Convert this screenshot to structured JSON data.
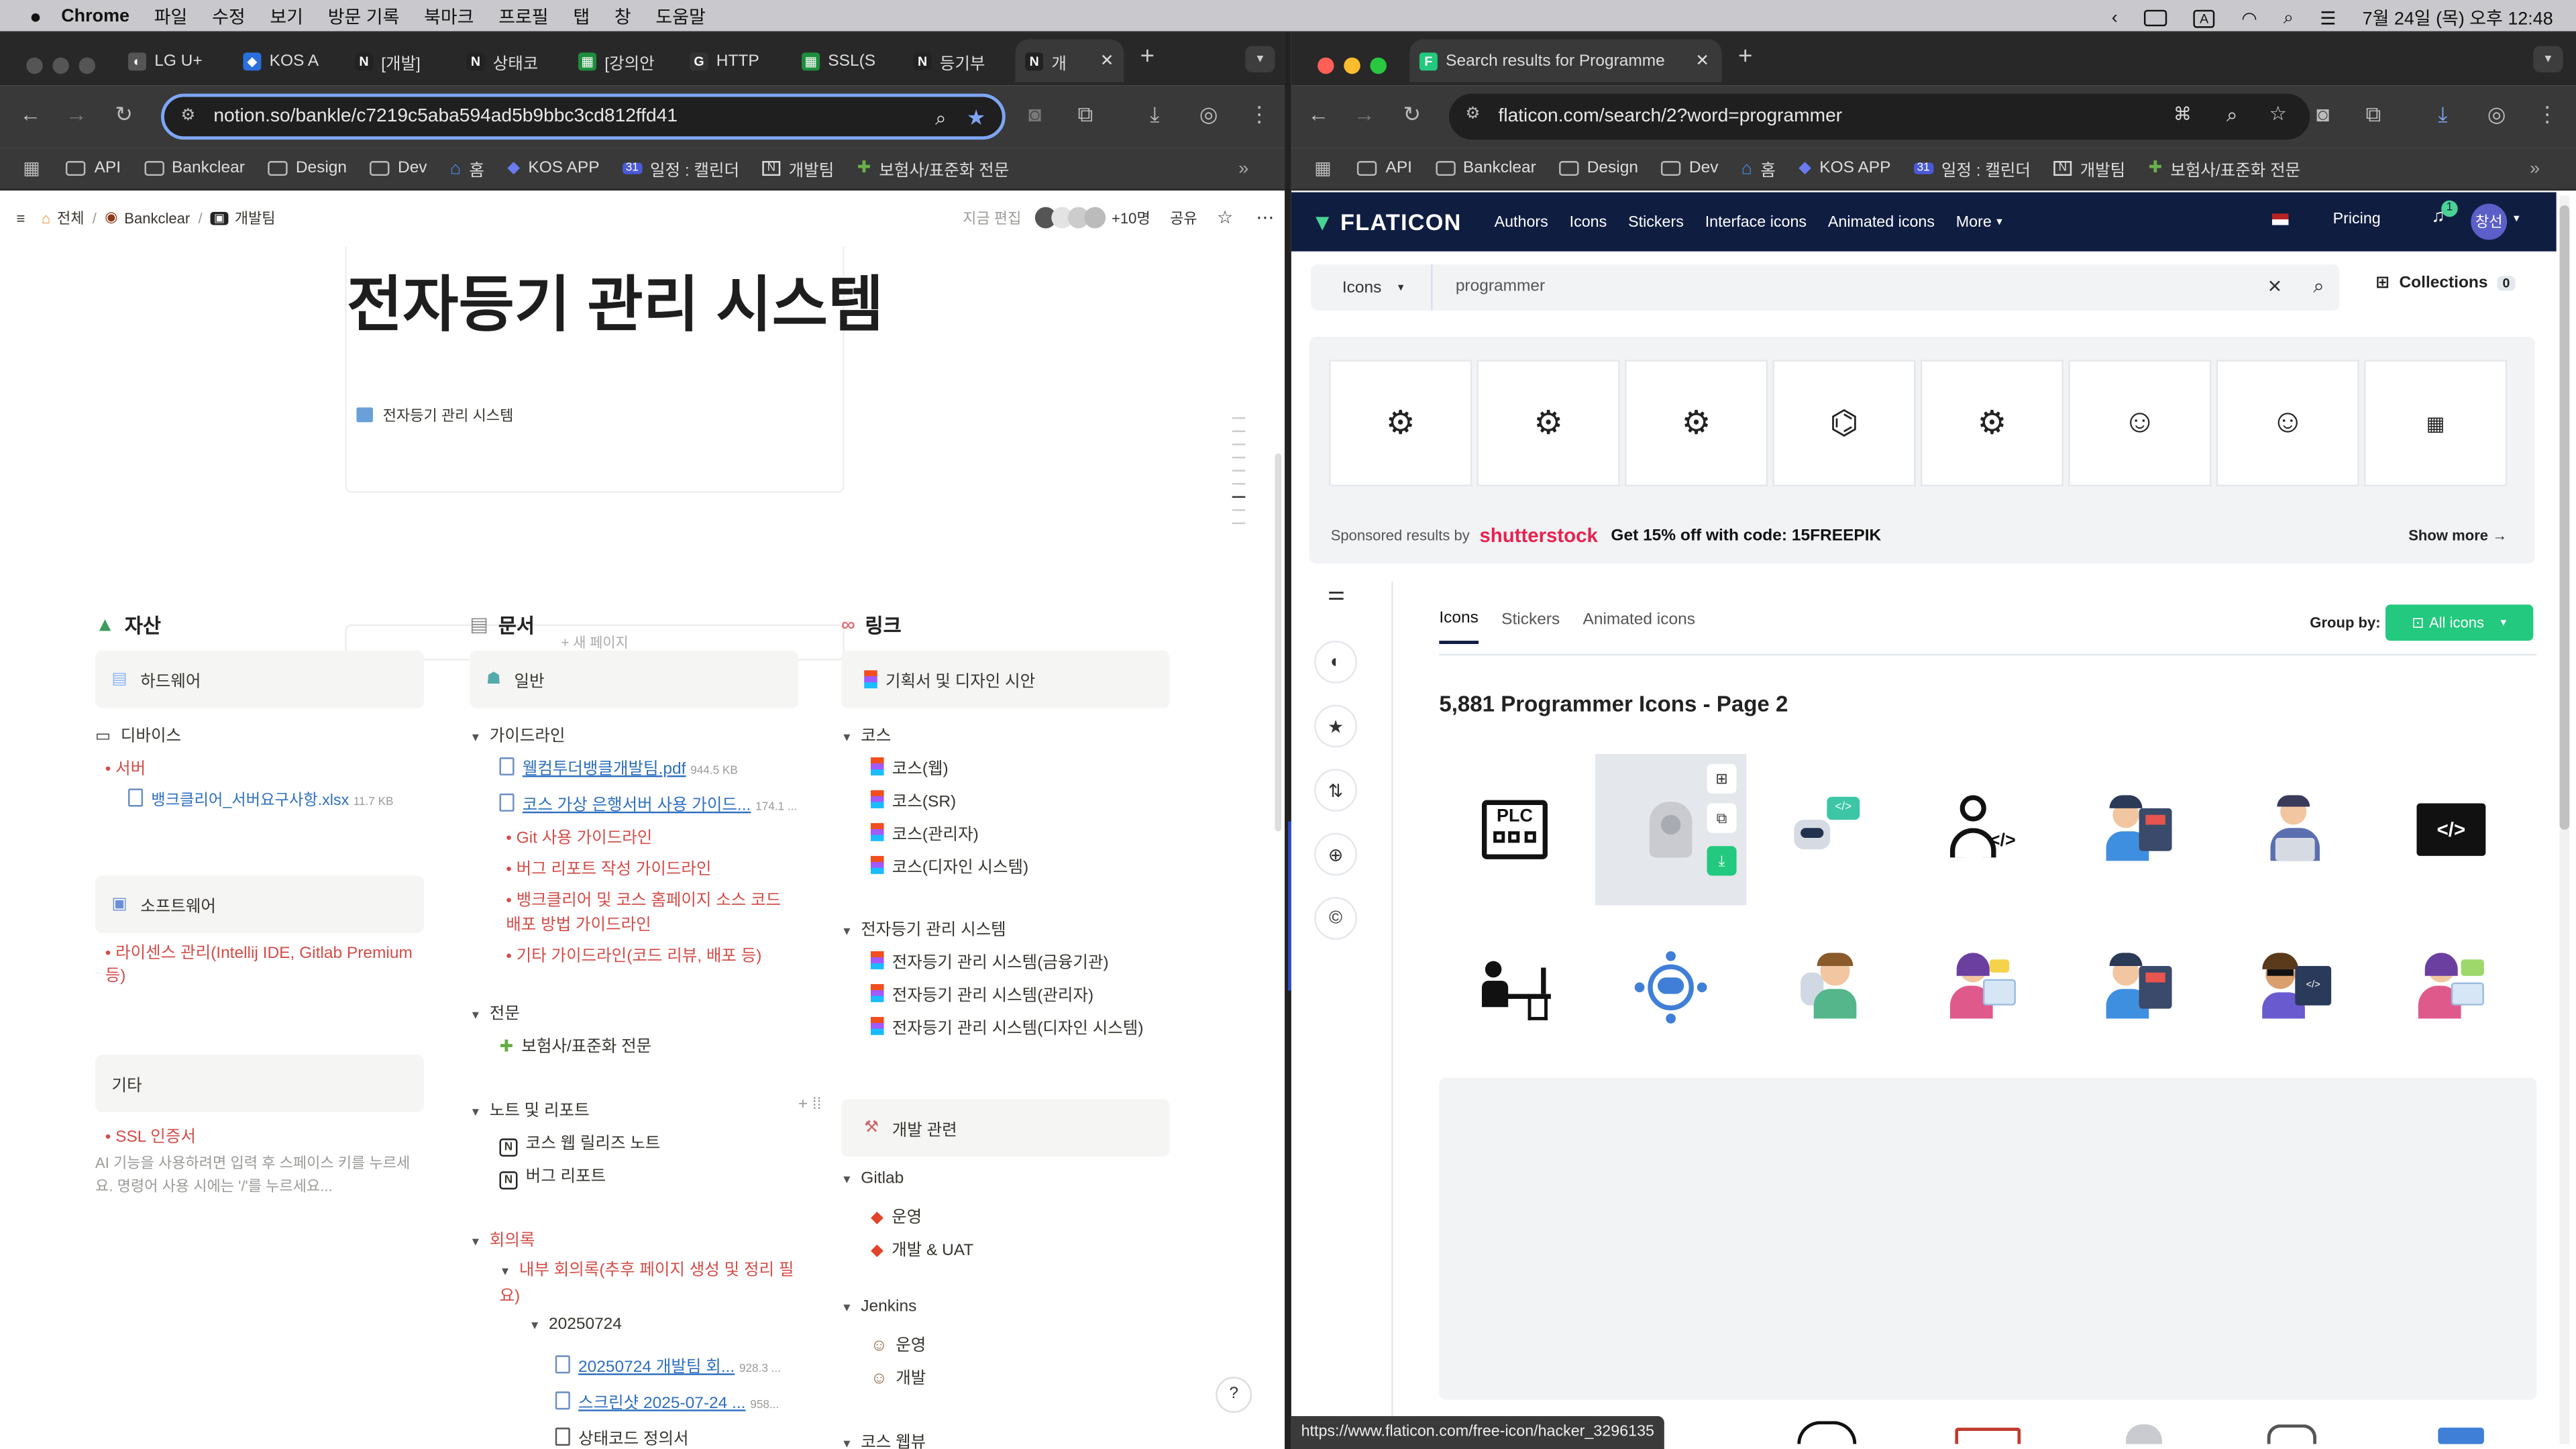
{
  "menubar": {
    "apple": "",
    "app": "Chrome",
    "items": [
      "파일",
      "수정",
      "보기",
      "방문 기록",
      "북마크",
      "프로필",
      "탭",
      "창",
      "도움말"
    ],
    "input": "A",
    "clock": "7월 24일 (목) 오후 12:48"
  },
  "left": {
    "tabs": [
      "LG U+",
      "KOS A",
      "[개발]",
      "상태코",
      "[강의안",
      "HTTP",
      "SSL(S",
      "등기부",
      "개"
    ],
    "url": "notion.so/bankle/c7219c5aba594ad5b9bbc3cd812ffd41",
    "bookmarks": [
      "API",
      "Bankclear",
      "Design",
      "Dev",
      "홈",
      "KOS APP",
      "일정 : 캘린더",
      "개발팀",
      "보험사/표준화 전문"
    ],
    "breadcrumb": [
      "전체",
      "Bankclear",
      "개발팀"
    ],
    "topbar": {
      "edit": "지금 편집",
      "people": "+10명",
      "share": "공유"
    },
    "title": "전자등기 관리 시스템",
    "db_item": "전자등기 관리 시스템",
    "new_page": "+ 새 페이지",
    "col1": {
      "heading": "자산",
      "hw": "하드웨어",
      "device": "디바이스",
      "server": "서버",
      "server_file": "뱅크클리어_서버요구사항.xlsx",
      "server_size": "11.7 KB",
      "sw": "소프트웨어",
      "license": "라이센스 관리(Intellij IDE, Gitlab Premium 등)",
      "etc": "기타",
      "ssl": "SSL 인증서",
      "ai_hint": "AI 기능을 사용하려면 입력 후 스페이스 키를 누르세요. 명령어 사용 시에는 '/'를 누르세요..."
    },
    "col2": {
      "heading": "문서",
      "general": "일반",
      "guideline": "가이드라인",
      "pdf": "웰컴투더뱅클개발팀.pdf",
      "pdf_size": "944.5 KB",
      "vm": "코스 가상 은행서버 사용 가이드...",
      "vm_size": "174.1 ...",
      "items": [
        "Git 사용 가이드라인",
        "버그 리포트 작성 가이드라인",
        "뱅크클리어 및 코스 홈페이지 소스 코드 배포 방법 가이드라인",
        "기타 가이드라인(코드 리뷰, 배포 등)"
      ],
      "spec": "전문",
      "spec_item": "보험사/표준화 전문",
      "notes": "노트 및 리포트",
      "note_items": [
        "코스 웹 릴리즈 노트",
        "버그 리포트"
      ],
      "minutes": "회의록",
      "internal": "내부 회의록(추후 페이지 생성 및 정리 필요)",
      "date": "20250724",
      "file1": "20250724 개발팀 회...",
      "file1_size": "928.3 ...",
      "file2": "스크린샷 2025-07-24 ...",
      "file2_size": "958...",
      "status": "상태코드 정의서"
    },
    "col3": {
      "heading": "링크",
      "plan": "기획서 및 디자인 시안",
      "kos": "코스",
      "kos_items": [
        "코스(웹)",
        "코스(SR)",
        "코스(관리자)",
        "코스(디자인 시스템)"
      ],
      "ereg": "전자등기 관리 시스템",
      "ereg_items": [
        "전자등기 관리 시스템(금융기관)",
        "전자등기 관리 시스템(관리자)",
        "전자등기 관리 시스템(디자인 시스템)"
      ],
      "dev": "개발 관련",
      "gitlab": "Gitlab",
      "gitlab_items": [
        "운영",
        "개발 & UAT"
      ],
      "jenkins": "Jenkins",
      "jenkins_items": [
        "운영",
        "개발"
      ],
      "kosweb": "코스 웹뷰"
    }
  },
  "right": {
    "tab_title": "Search results for Programme",
    "url": "flaticon.com/search/2?word=programmer",
    "bookmarks": [
      "API",
      "Bankclear",
      "Design",
      "Dev",
      "홈",
      "KOS APP",
      "일정 : 캘린더",
      "개발팀",
      "보험사/표준화 전문"
    ],
    "nav": {
      "logo": "FLATICON",
      "items": [
        "Authors",
        "Icons",
        "Stickers",
        "Interface icons",
        "Animated icons",
        "More"
      ],
      "pricing": "Pricing",
      "badge": "1",
      "user": "창선"
    },
    "search": {
      "type": "Icons",
      "query": "programmer",
      "collections": "Collections",
      "collections_count": "0"
    },
    "sponsored": {
      "label": "Sponsored results by",
      "brand": "shutterstock",
      "promo": "Get 15% off with code: 15FREEPIK",
      "more": "Show more"
    },
    "tabs": [
      "Icons",
      "Stickers",
      "Animated icons"
    ],
    "group_by": "Group by:",
    "all_icons": "All icons",
    "heading": "5,881 Programmer Icons - Page 2",
    "plc": "PLC",
    "status_url": "https://www.flaticon.com/free-icon/hacker_3296135",
    "colors": {
      "brand": "#0f1d41",
      "green": "#4ad295",
      "accent": "#23c97e"
    }
  }
}
